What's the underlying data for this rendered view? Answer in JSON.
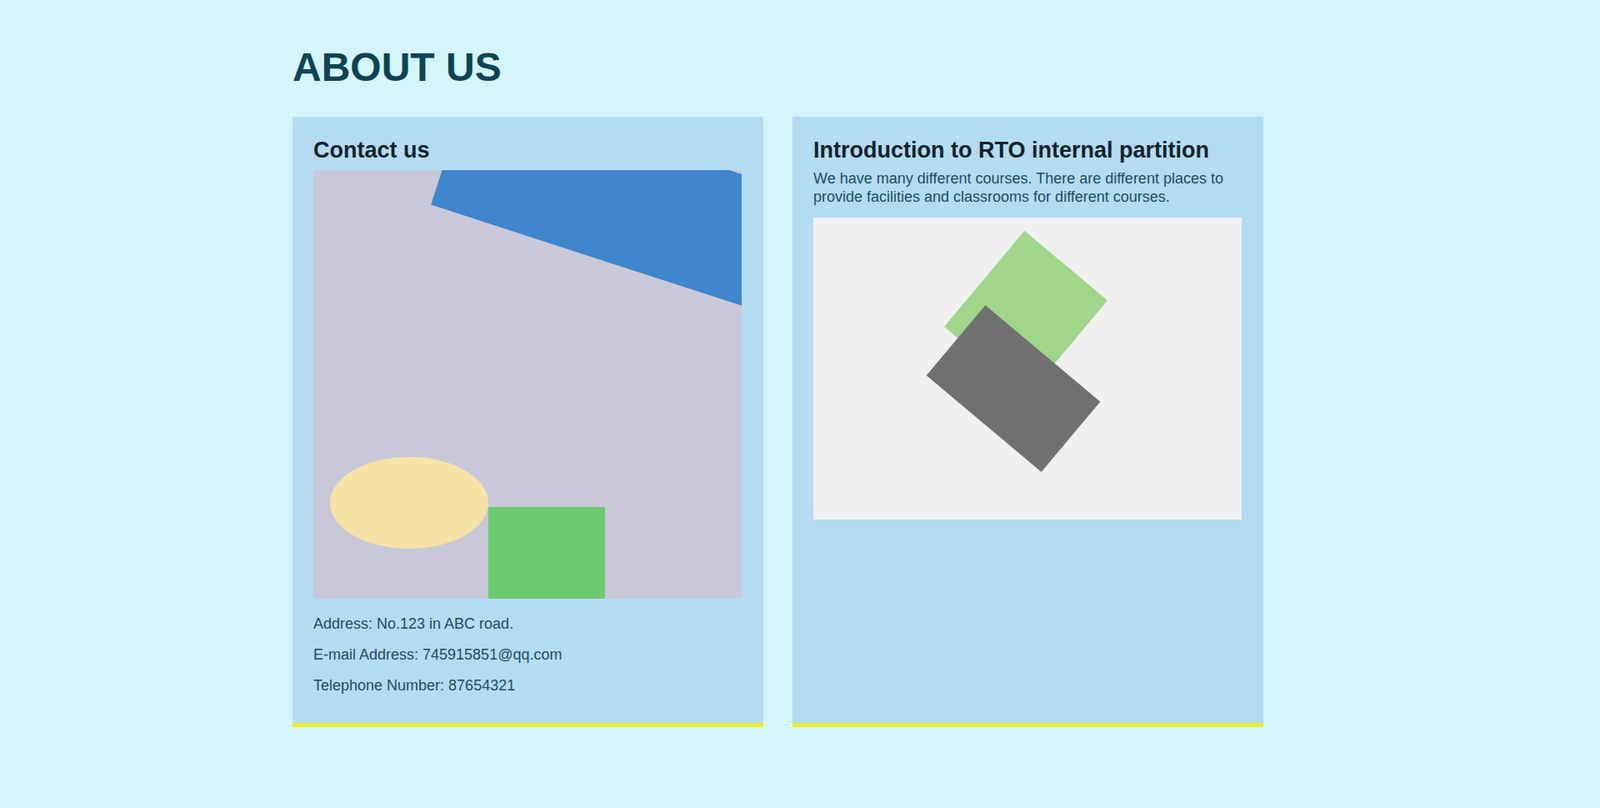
{
  "page": {
    "title": "ABOUT US"
  },
  "cards": [
    {
      "kind": "contact",
      "title": "Contact us",
      "text": "",
      "lines": [
        "Address: No.123 in ABC road.",
        "E-mail Address: 745915851@qq.com",
        "Telephone Number: 87654321"
      ]
    },
    {
      "kind": "intro",
      "title": "Introduction to RTO internal partition",
      "text": "We have many different courses. There are different places to provide facilities and classrooms for different courses.",
      "lines": []
    }
  ]
}
